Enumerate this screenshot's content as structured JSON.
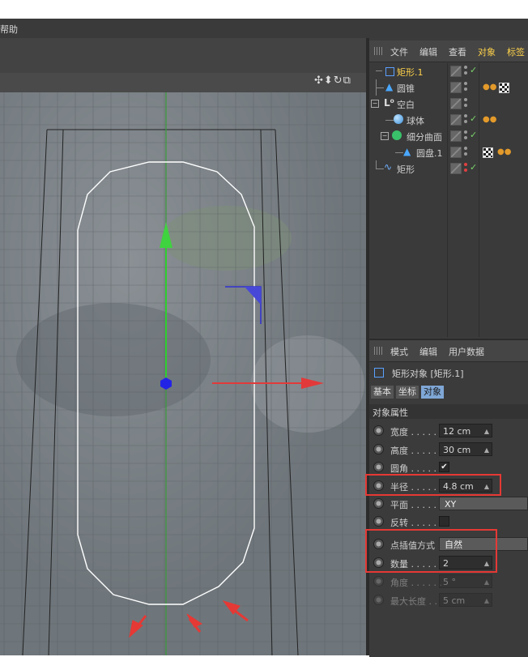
{
  "menubar": {
    "help_label": "帮助"
  },
  "viewport": {
    "tool_icons": "✣⬍↻⧉"
  },
  "object_manager": {
    "menu": [
      "文件",
      "编辑",
      "查看",
      "对象",
      "标签"
    ],
    "objects": [
      {
        "name": "矩形.1",
        "indent": 0,
        "icon": "rectangle-spline-icon",
        "selected": true
      },
      {
        "name": "圆锥",
        "indent": 1,
        "icon": "cone-icon"
      },
      {
        "name": "空白",
        "indent": 0,
        "icon": "null-object-icon"
      },
      {
        "name": "球体",
        "indent": 1,
        "icon": "sphere-icon"
      },
      {
        "name": "细分曲面",
        "indent": 1,
        "icon": "subdivision-surface-icon"
      },
      {
        "name": "圆盘.1",
        "indent": 2,
        "icon": "disc-icon"
      },
      {
        "name": "矩形",
        "indent": 0,
        "icon": "spline-icon"
      }
    ]
  },
  "attribute_manager": {
    "menu": [
      "模式",
      "编辑",
      "用户数据"
    ],
    "object_title": "矩形对象 [矩形.1]",
    "tabs": [
      "基本",
      "坐标",
      "对象"
    ],
    "active_tab": "对象",
    "section_title": "对象属性",
    "properties": [
      {
        "label": "宽度 . . . . . .",
        "value": "12 cm",
        "type": "field"
      },
      {
        "label": "高度 . . . . . .",
        "value": "30 cm",
        "type": "field"
      },
      {
        "label": "圆角 . . . . . .",
        "value": "✔",
        "type": "checkbox"
      },
      {
        "label": "半径 . . . . . .",
        "value": "4.8 cm",
        "type": "field"
      },
      {
        "label": "平面 . . . . . .",
        "value": "XY",
        "type": "dropdown"
      },
      {
        "label": "反转 . . . . . .",
        "value": "",
        "type": "checkbox"
      },
      {
        "label": "点插值方式",
        "value": "自然",
        "type": "dropdown"
      },
      {
        "label": "数量 . . . . . .",
        "value": "2",
        "type": "field"
      },
      {
        "label": "角度 . . . . . .",
        "value": "5 °",
        "type": "field",
        "disabled": true
      },
      {
        "label": "最大长度 . .",
        "value": "5 cm",
        "type": "field",
        "disabled": true
      }
    ]
  },
  "colors": {
    "highlight_box": "#e53935",
    "y_axis": "#3fd33f",
    "x_axis": "#e23a3a",
    "z_axis": "#3535e0",
    "selected_text": "#ffd24a"
  }
}
